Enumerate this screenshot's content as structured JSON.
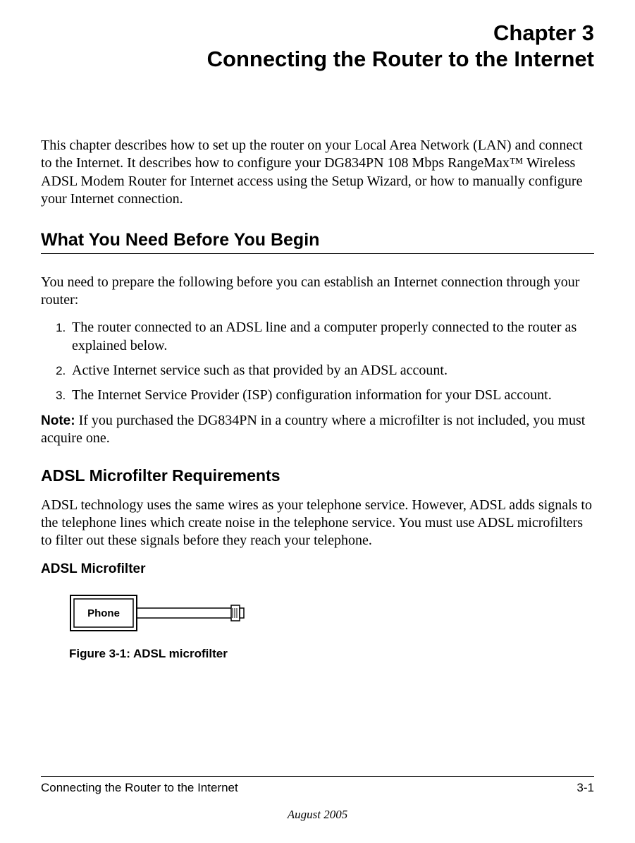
{
  "chapter": {
    "label": "Chapter 3",
    "title": "Connecting the Router to the Internet"
  },
  "intro": "This chapter describes how to set up the router on your Local Area Network (LAN) and connect to the Internet. It describes how to configure your DG834PN 108 Mbps RangeMax™ Wireless ADSL Modem Router for Internet access using the Setup Wizard, or how to manually configure your Internet connection.",
  "sections": {
    "begin": {
      "heading": "What You Need Before You Begin",
      "intro": "You need to prepare the following before you can establish an Internet connection through your router:",
      "list": [
        "The router connected to an ADSL line and a computer properly connected to the router as explained below.",
        "Active Internet service such as that provided by an ADSL account.",
        "The Internet Service Provider (ISP) configuration information for your DSL account."
      ],
      "noteLabel": "Note:",
      "note": " If you purchased the DG834PN in a country where a microfilter is not included, you must acquire one."
    },
    "microfilter": {
      "heading": "ADSL Microfilter Requirements",
      "intro": "ADSL technology uses the same wires as your telephone service. However, ADSL adds signals to the telephone lines which create noise in the telephone service. You must use ADSL microfilters to filter out these signals before they reach your telephone.",
      "subheading": "ADSL Microfilter",
      "figureCaption": "Figure 3-1:  ADSL microfilter",
      "figureLabel": "Phone"
    }
  },
  "footer": {
    "left": "Connecting the Router to the Internet",
    "right": "3-1",
    "date": "August 2005"
  }
}
